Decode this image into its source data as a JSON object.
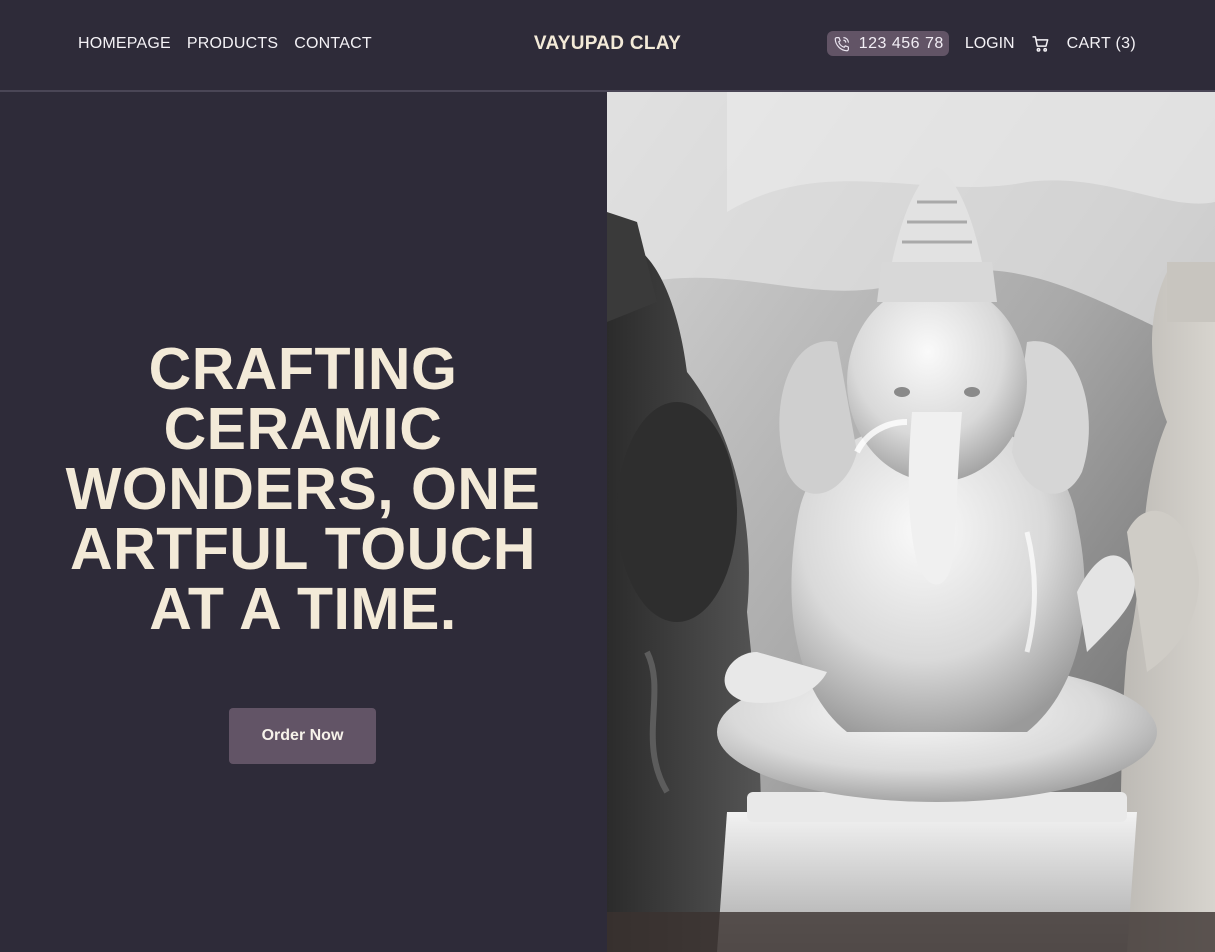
{
  "nav": {
    "links": [
      "HOMEPAGE",
      "PRODUCTS",
      "CONTACT"
    ],
    "brand": "VAYUPAD CLAY",
    "phone": "123 456 78",
    "login": "LOGIN",
    "cart": "CART (3)"
  },
  "hero": {
    "headline": "CRAFTING CERAMIC WONDERS, ONE ARTFUL TOUCH AT A TIME.",
    "cta": "Order Now"
  },
  "icons": {
    "phone": "phone-icon",
    "cart": "cart-icon"
  },
  "colors": {
    "background": "#2e2b39",
    "accent": "#625466",
    "headline": "#f3ead8"
  }
}
